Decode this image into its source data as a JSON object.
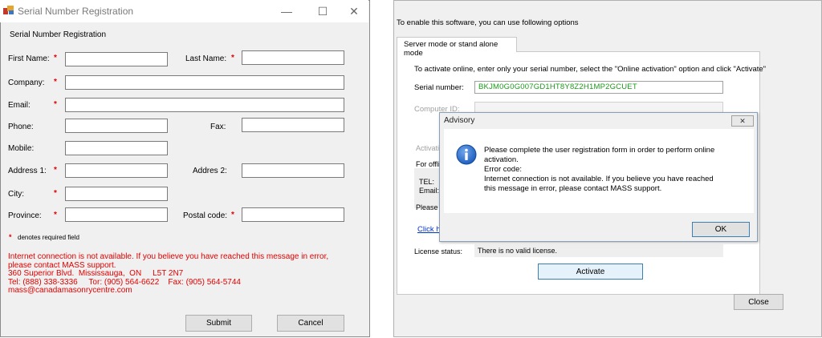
{
  "left_window": {
    "title": "Serial Number Registration",
    "section_title": "Serial Number Registration",
    "fields": {
      "first_name": "First Name:",
      "last_name": "Last Name:",
      "company": "Company:",
      "email": "Email:",
      "phone": "Phone:",
      "fax": "Fax:",
      "mobile": "Mobile:",
      "address1": "Address 1:",
      "address2": "Addres 2:",
      "city": "City:",
      "province": "Province:",
      "postal_code": "Postal code:"
    },
    "required_marker": "*",
    "required_note": "denotes required field",
    "error_lines": [
      "Internet connection is not available. If you believe you have reached this message in error,",
      "please contact MASS support.",
      "360 Superior Blvd.  Mississauga,  ON     L5T 2N7",
      "Tel: (888) 338-3336     Tor: (905) 564-6622    Fax: (905) 564-5744",
      "mass@canadamasonrycentre.com"
    ],
    "submit_label": "Submit",
    "cancel_label": "Cancel",
    "window_controls": {
      "minimize": "—",
      "maximize": "☐",
      "close": "✕"
    }
  },
  "right_window": {
    "header": "To enable this software, you can use following options",
    "tab_label": "Server mode or stand alone mode",
    "instruction": "To activate online, enter only your serial number, select the \"Online activation\" option and click \"Activate\"",
    "serial_label": "Serial number:",
    "serial_value": "BKJM0G0G007GD1HT8Y8Z2H1MP2GCUET",
    "computer_id_label": "Computer ID:",
    "activation_partial": "Activatio",
    "offline_partial": "For offli",
    "tel_partial": "TEL:",
    "email_partial": "Email:",
    "please_partial": "Please",
    "click_partial": "Click h",
    "license_status_label": "License status:",
    "license_status_value": "There is no valid license.",
    "activate_label": "Activate",
    "close_label": "Close"
  },
  "dialog": {
    "title": "Advisory",
    "close_glyph": "✕",
    "message_lines": [
      "Please complete the user registration form in order to perform online",
      "activation.",
      "Error code:",
      "Internet connection is not available. If you believe you have reached",
      "this message in error, please contact MASS support."
    ],
    "ok_label": "OK"
  },
  "colors": {
    "required_red": "#e00000",
    "serial_green": "#1a9a1a",
    "info_blue": "#1f5fbf",
    "window_bg": "#f0f0f0"
  }
}
